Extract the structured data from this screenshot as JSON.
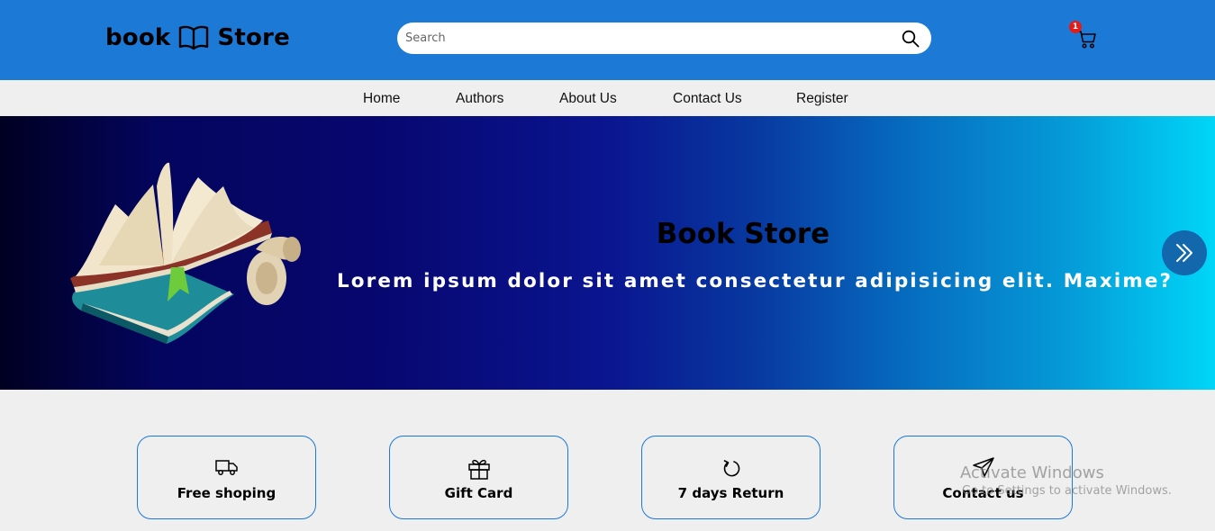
{
  "header": {
    "logo_left": "book",
    "logo_right": "Store",
    "logo_icon": "open-book-icon",
    "search_placeholder": "Search",
    "search_icon": "magnifier-icon",
    "cart_icon": "cart-icon",
    "cart_count": "1",
    "bar_color": "#1d79d6"
  },
  "nav": {
    "items": [
      "Home",
      "Authors",
      "About Us",
      "Contact Us",
      "Register"
    ]
  },
  "hero": {
    "title": "Book Store",
    "text": "Lorem ipsum dolor sit amet consectetur adipisicing elit. Maxime?",
    "next_icon": "double-chevron-right-icon",
    "image": "open-books-scroll-illustration"
  },
  "features": [
    {
      "label": "Free shoping",
      "icon": "truck-icon"
    },
    {
      "label": "Gift Card",
      "icon": "gift-icon"
    },
    {
      "label": "7 days Return",
      "icon": "rotate-icon"
    },
    {
      "label": "Contact us",
      "icon": "send-icon"
    }
  ],
  "watermark": {
    "line1": "Activate Windows",
    "line2": "Go to Settings to activate Windows."
  }
}
